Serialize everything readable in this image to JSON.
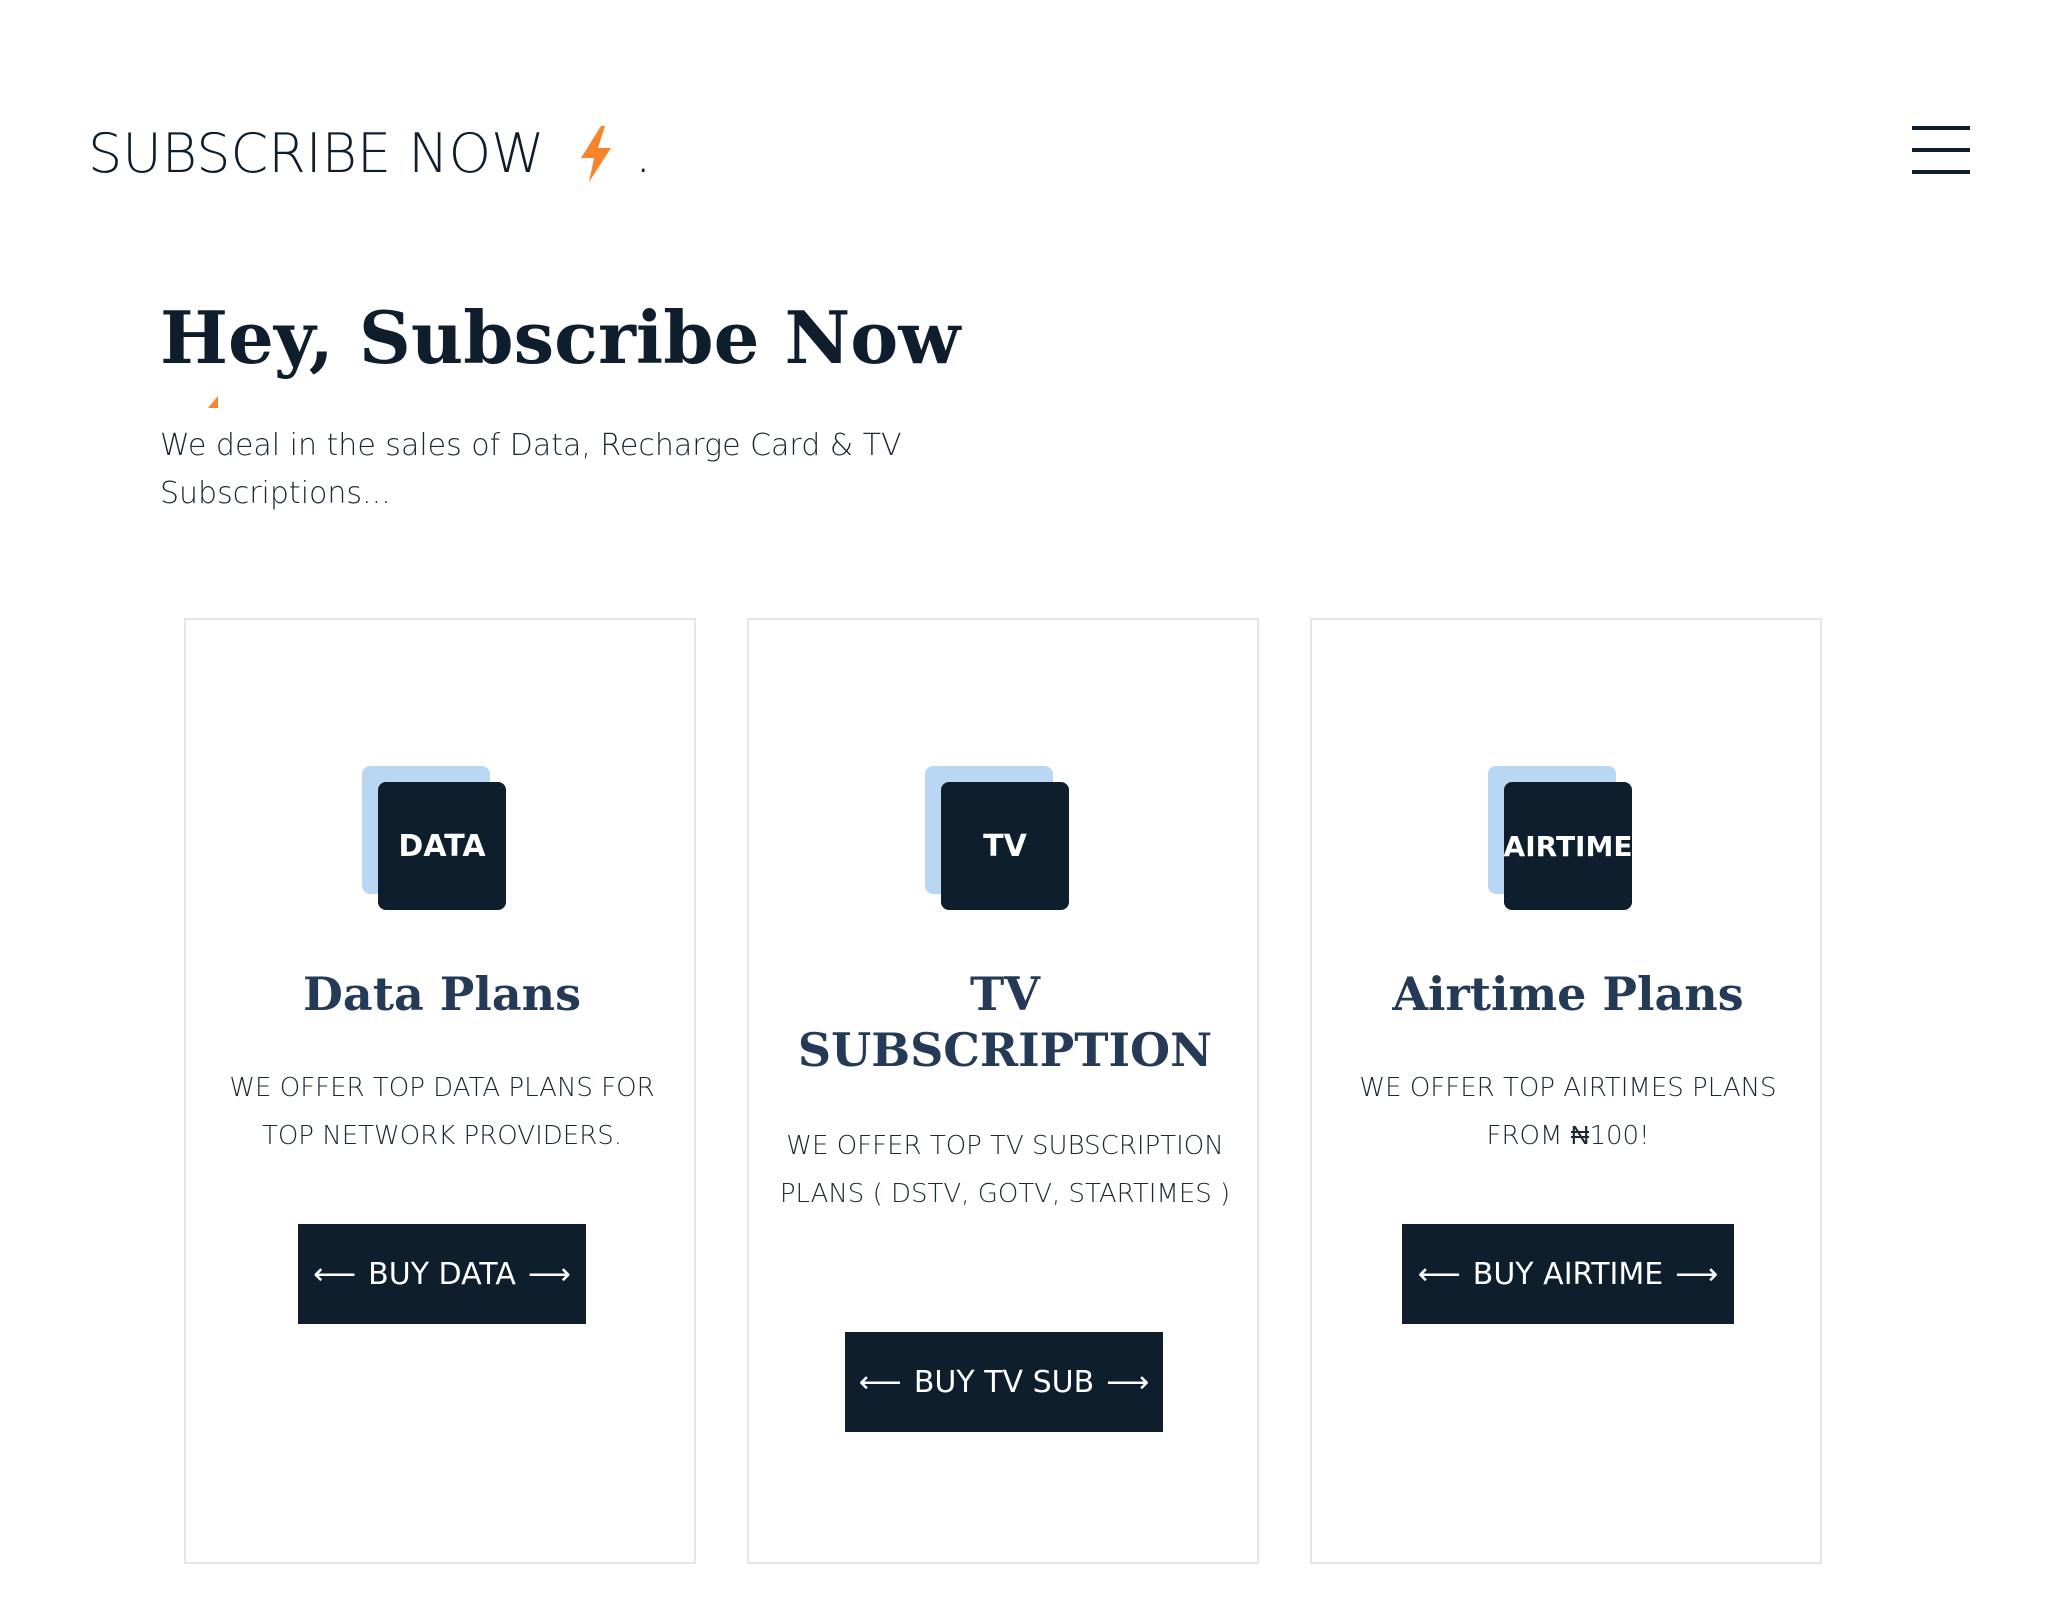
{
  "header": {
    "logo_text": "SUBSCRIBE NOW",
    "logo_dot": ".",
    "logo_icon": "lightning-bolt-icon",
    "menu_icon": "hamburger-menu-icon",
    "accent_color": "#f7842d"
  },
  "hero": {
    "title": "Hey, Subscribe Now",
    "subtitle": "We deal in the sales of Data, Recharge Card & TV Subscriptions..."
  },
  "cards": [
    {
      "badge": "DATA",
      "title": "Data Plans",
      "description": "WE OFFER TOP DATA PLANS FOR TOP NETWORK PROVIDERS.",
      "button_label": "BUY DATA"
    },
    {
      "badge": "TV",
      "title": "TV SUBSCRIPTION",
      "description": "WE OFFER TOP TV SUBSCRIPTION PLANS ( DSTV, GOTV, STARTIMES )",
      "button_label": "BUY TV SUB"
    },
    {
      "badge": "AIRTIME",
      "title": "Airtime Plans",
      "description": "WE OFFER TOP AIRTIMES PLANS FROM ₦100!",
      "button_label": "BUY AIRTIME"
    }
  ],
  "colors": {
    "navy": "#0f1e2c",
    "card_title": "#243a56",
    "icon_back": "#b9d7f3",
    "border": "#e3e7eb",
    "accent": "#f7842d"
  },
  "arrows": {
    "left": "⟵",
    "right": "⟶"
  }
}
